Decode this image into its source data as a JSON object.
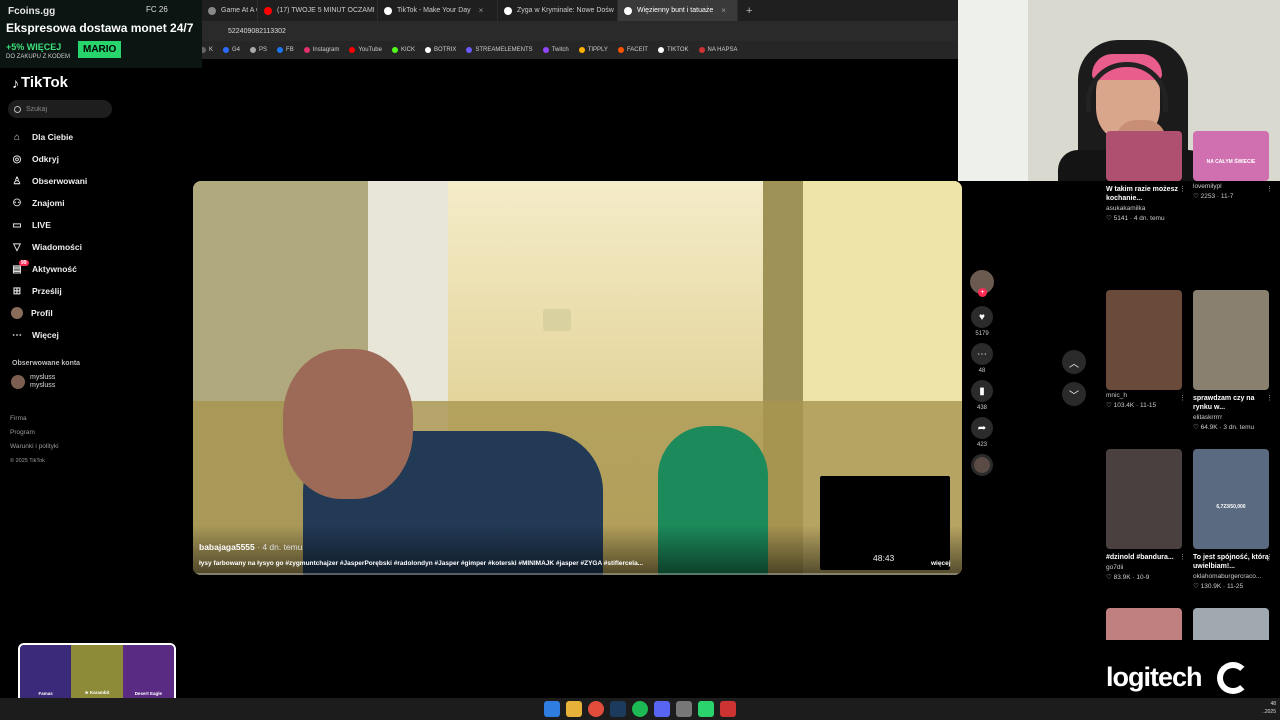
{
  "promo": {
    "site": "Fcoins.gg",
    "status": "FC 26",
    "title": "Ekspresowa dostawa monet 24/7",
    "bonus": "+5% WIĘCEJ",
    "sub": "DO ZAKUPU Z KODEM",
    "code": "MARIO"
  },
  "browser": {
    "tabs": [
      {
        "label": "Game At A Gl",
        "color": "#888888"
      },
      {
        "label": "(17) TWOJE 5 MINUT OCZAMI",
        "color": "#ff0000"
      },
      {
        "label": "TikTok - Make Your Day",
        "color": "#ffffff"
      },
      {
        "label": "Zyga w Kryminale: Nowe Dośw",
        "color": "#ffffff"
      },
      {
        "label": "Więzienny bunt i tatuaże",
        "color": "#ffffff"
      }
    ],
    "new_tab": "+",
    "url": "522409082113302",
    "bookmarks": [
      {
        "label": "K",
        "color": "#666666"
      },
      {
        "label": "G4",
        "color": "#2b6cff"
      },
      {
        "label": "PS",
        "color": "#aaaaaa"
      },
      {
        "label": "FB",
        "color": "#1877f2"
      },
      {
        "label": "Instagram",
        "color": "#e1306c"
      },
      {
        "label": "YouTube",
        "color": "#ff0000"
      },
      {
        "label": "KICK",
        "color": "#53fc18"
      },
      {
        "label": "BOTRIX",
        "color": "#ffffff"
      },
      {
        "label": "STREAMELEMENTS",
        "color": "#6a5cff"
      },
      {
        "label": "Twitch",
        "color": "#9146ff"
      },
      {
        "label": "TIPPLY",
        "color": "#ffb000"
      },
      {
        "label": "FACEIT",
        "color": "#ff5500"
      },
      {
        "label": "TIKTOK",
        "color": "#ffffff"
      },
      {
        "label": "NA HAPSA",
        "color": "#cc3333"
      }
    ]
  },
  "sidebar": {
    "brand": "TikTok",
    "search_placeholder": "Szukaj",
    "nav": [
      {
        "label": "Dla Ciebie",
        "icon": "⌂"
      },
      {
        "label": "Odkryj",
        "icon": "◎"
      },
      {
        "label": "Obserwowani",
        "icon": "♙"
      },
      {
        "label": "Znajomi",
        "icon": "⚇"
      },
      {
        "label": "LIVE",
        "icon": "▭"
      },
      {
        "label": "Wiadomości",
        "icon": "▽"
      },
      {
        "label": "Aktywność",
        "icon": "▤",
        "badge": "99"
      },
      {
        "label": "Prześlij",
        "icon": "⊞"
      },
      {
        "label": "Profil",
        "icon": ""
      },
      {
        "label": "Więcej",
        "icon": "⋯"
      }
    ],
    "following_title": "Obserwowane konta",
    "following": [
      {
        "name": "mysluss",
        "handle": "mysluss"
      }
    ],
    "links": [
      "Firma",
      "Program",
      "Warunki i polityki"
    ],
    "copyright": "© 2025 TikTok"
  },
  "video": {
    "author": "babajaga5555",
    "ago": " · 4 dn. temu",
    "caption": "łysy farbowany na łysyo go #zygmuntchajzer #JasperPorębski #radolondyn #Jasper #gimper #koterski #MINIMAJK #jasper #ZYGA #stiflercela...",
    "duration": "48:43",
    "more": "więcej",
    "progress": 0
  },
  "actions": {
    "likes": "5179",
    "comments": "48",
    "saves": "438",
    "shares": "423"
  },
  "grid": [
    {
      "title": "W takim razie możesz kochanie...",
      "user": "asukakamilka",
      "meta": "♡ 5141 · 4 dn. temu",
      "color": "#b05070",
      "overlay": ""
    },
    {
      "title": "",
      "user": "lovemilypl",
      "meta": "♡ 2253 · 11-7",
      "color": "#d070b0",
      "overlay": "NA CAŁYM ŚWIECIE"
    },
    {
      "title": "",
      "user": "mnic_h",
      "meta": "♡ 103.4K · 11-15",
      "color": "#6a4b3a",
      "overlay": ""
    },
    {
      "title": "sprawdzam czy na rynku w...",
      "user": "elitaskrrrrr",
      "meta": "♡ 64.9K · 3 dn. temu",
      "color": "#8a8070",
      "overlay": ""
    },
    {
      "title": "#dzinold #bandura...",
      "user": "go7dii",
      "meta": "♡ 83.9K · 10-9",
      "color": "#4a4040",
      "overlay": ""
    },
    {
      "title": "To jest spójność, którą uwielbiam!...",
      "user": "oklahomaburgercraco...",
      "meta": "♡ 130.9K · 11-25",
      "color": "#5a6a80",
      "overlay": "6,723/50,000"
    },
    {
      "title": "",
      "user": "",
      "meta": "",
      "color": "#c08080",
      "overlay": ""
    },
    {
      "title": "",
      "user": "",
      "meta": "",
      "color": "#a0a8b0",
      "overlay": ""
    }
  ],
  "weapons": [
    {
      "name": "Famas",
      "skin": "Serpent"
    },
    {
      "name": "★ Karambit",
      "skin": "Case Hardened"
    },
    {
      "name": "Desert Eagle",
      "skin": "Kumicho Dragon"
    }
  ],
  "logitech": "logitech",
  "clock": {
    "time": "48",
    "date": "..2025"
  }
}
